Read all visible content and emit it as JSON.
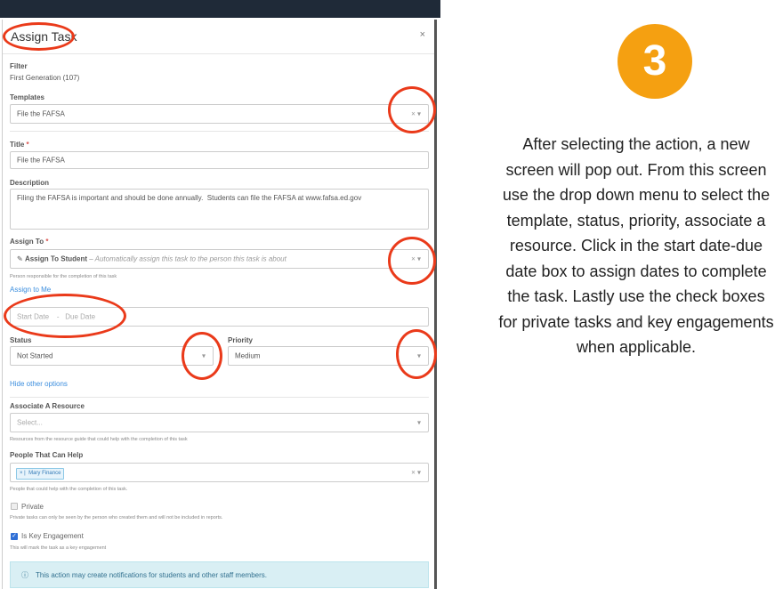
{
  "modal": {
    "title": "Assign Task",
    "close": "×",
    "filter_label": "Filter",
    "filter_value": "First Generation (107)",
    "templates_label": "Templates",
    "template_value": "File the FAFSA",
    "title_label": "Title",
    "required_mark": "*",
    "title_value": "File the FAFSA",
    "description_label": "Description",
    "description_value": "Filing the FAFSA is important and should be done annually.  Students can file the FAFSA at www.fafsa.ed.gov",
    "assign_to_label": "Assign To",
    "assign_to_value": "Assign To Student",
    "assign_to_note": "– Automatically assign this task to the person this task is about",
    "assign_to_help": "Person responsible for the completion of this task",
    "assign_to_me": "Assign to Me",
    "start_date_placeholder": "Start Date",
    "date_separator": "-",
    "due_date_placeholder": "Due Date",
    "status_label": "Status",
    "status_value": "Not Started",
    "priority_label": "Priority",
    "priority_value": "Medium",
    "hide_options": "Hide other options",
    "resource_label": "Associate A Resource",
    "resource_placeholder": "Select...",
    "resource_help": "Resources from the resource guide that could help with the completion of this task",
    "people_label": "People That Can Help",
    "people_tag": "Mary Finance",
    "people_help": "People that could help with the completion of this task.",
    "private_label": "Private",
    "private_checked": false,
    "private_help": "Private tasks can only be seen by the person who created them and will not be included in reports.",
    "key_label": "Is Key Engagement",
    "key_checked": true,
    "key_help": "This will mark the task as a key engagement",
    "alert_text": "This action may create notifications for students and other staff members."
  },
  "controls": {
    "clear": "×",
    "caret": "▾",
    "tag_remove": "×",
    "check": "✓",
    "info": "ⓘ",
    "assign_icon": "✎"
  },
  "step_number": "3",
  "instructions": "After selecting the action, a new screen will pop out. From this screen use the drop down menu to select the template, status, priority, associate a resource. Click in the start date-due date box to assign dates to complete the task. Lastly use the check boxes for private tasks and key engagements when applicable.",
  "colors": {
    "highlight": "#ea3a1a",
    "badge": "#f5a011",
    "link": "#3a8dde",
    "alert_bg": "#d9eff4"
  },
  "icons": [
    "close-icon",
    "clear-icon",
    "chevron-down-icon",
    "pencil-icon",
    "info-icon",
    "check-icon"
  ]
}
